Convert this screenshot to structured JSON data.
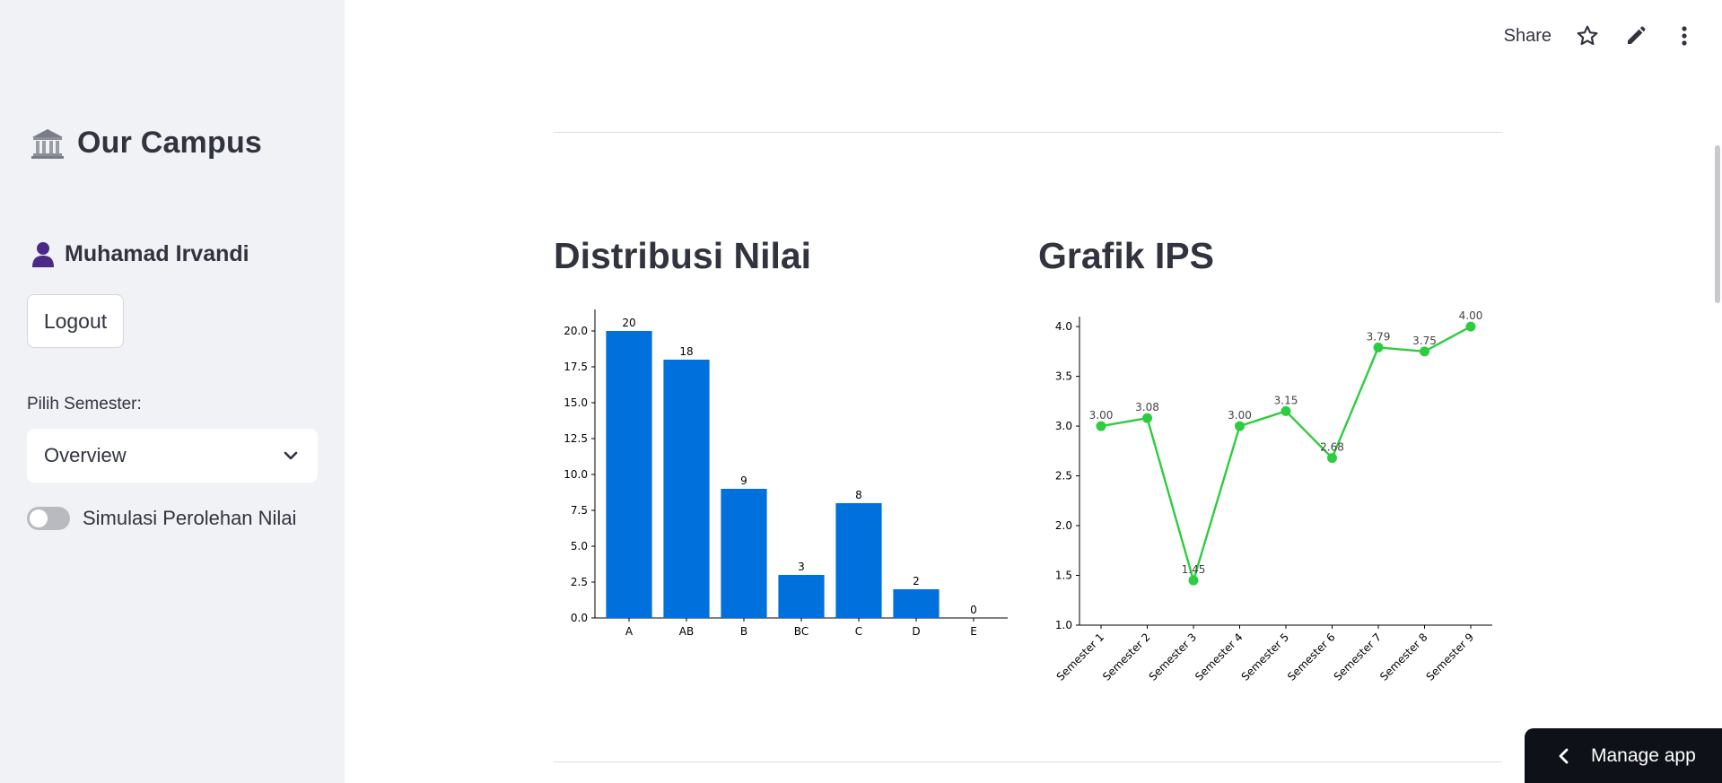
{
  "sidebar": {
    "brand_title": "Our Campus",
    "brand_icon": "classical-building-icon",
    "user_name": "Muhamad Irvandi",
    "user_icon": "person-silhouette-icon",
    "logout_label": "Logout",
    "semester_label": "Pilih Semester:",
    "semester_selected": "Overview",
    "toggle_label": "Simulasi Perolehan Nilai",
    "toggle_on": false
  },
  "toolbar": {
    "share_label": "Share",
    "icons": [
      "star-icon",
      "pencil-icon",
      "kebab-menu-icon"
    ]
  },
  "main": {
    "left_title": "Distribusi Nilai",
    "right_title": "Grafik IPS"
  },
  "manage_app_label": "Manage app",
  "colors": {
    "sidebar_bg": "#f0f2f6",
    "bar": "#0070dd",
    "line": "#2ecc40",
    "text": "#31333f"
  },
  "chart_data": [
    {
      "type": "bar",
      "categories": [
        "A",
        "AB",
        "B",
        "BC",
        "C",
        "D",
        "E"
      ],
      "values": [
        20,
        18,
        9,
        3,
        8,
        2,
        0
      ],
      "data_labels": [
        "20",
        "18",
        "9",
        "3",
        "8",
        "2",
        "0"
      ],
      "yticks": [
        "0.0",
        "2.5",
        "5.0",
        "7.5",
        "10.0",
        "12.5",
        "15.0",
        "17.5",
        "20.0"
      ],
      "ylim": [
        0,
        21.5
      ],
      "grid": false
    },
    {
      "type": "line",
      "categories": [
        "Semester 1",
        "Semester 2",
        "Semester 3",
        "Semester 4",
        "Semester 5",
        "Semester 6",
        "Semester 7",
        "Semester 8",
        "Semester 9"
      ],
      "values": [
        3.0,
        3.08,
        1.45,
        3.0,
        3.15,
        2.68,
        3.79,
        3.75,
        4.0
      ],
      "data_labels": [
        "3.00",
        "3.08",
        "1.45",
        "3.00",
        "3.15",
        "2.68",
        "3.79",
        "3.75",
        "4.00"
      ],
      "yticks": [
        "1.0",
        "1.5",
        "2.0",
        "2.5",
        "3.0",
        "3.5",
        "4.0"
      ],
      "ylim": [
        1.0,
        4.1
      ],
      "grid": false
    }
  ]
}
